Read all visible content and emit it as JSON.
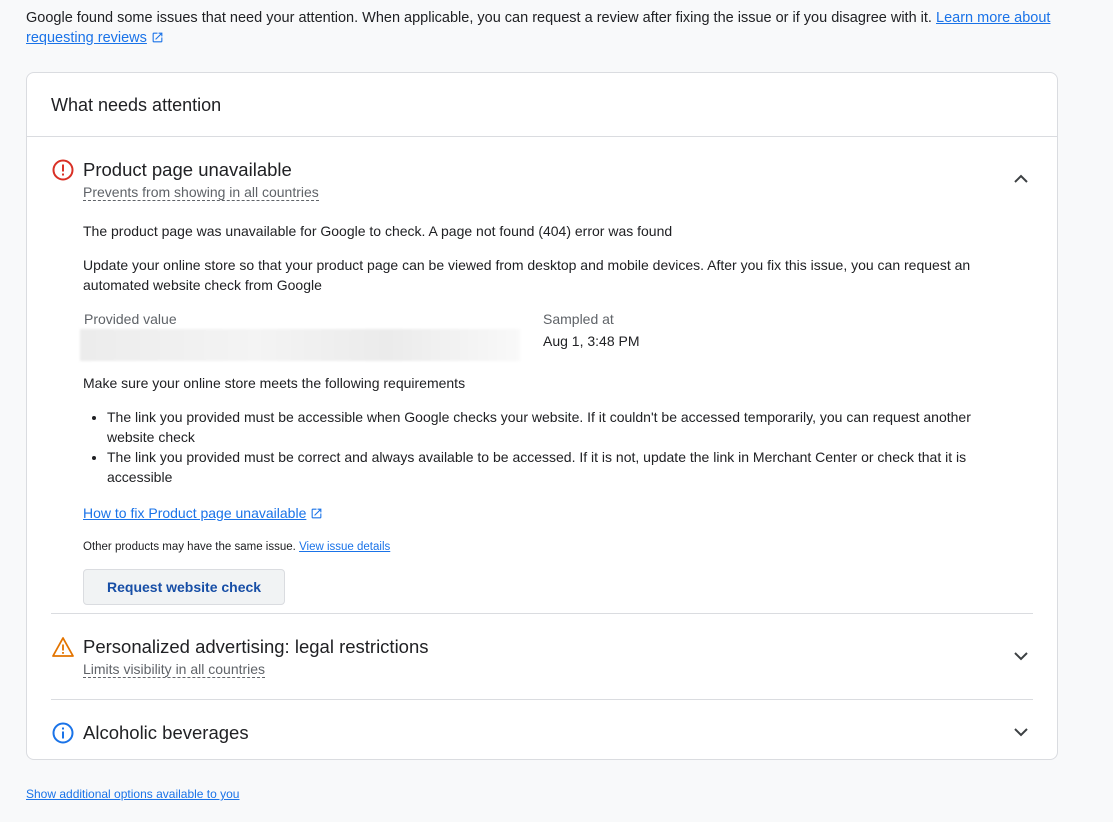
{
  "intro": {
    "text": "Google found some issues that need your attention. When applicable, you can request a review after fixing the issue or if you disagree with it.",
    "link_label": "Learn more about requesting reviews",
    "link_icon": "external-link-icon"
  },
  "card": {
    "title": "What needs attention",
    "issues": [
      {
        "title": "Product page unavailable",
        "subtitle": "Prevents from showing in all countries",
        "severity": "error",
        "icon": "error-circle-icon",
        "expanded": true,
        "detail_1": "The product page was unavailable for Google to check. A page not found (404) error was found",
        "detail_2": "Update your online store so that your product page can be viewed from desktop and mobile devices. After you fix this issue, you can request an automated website check from Google",
        "provided_value_label": "Provided value",
        "sampled_at_label": "Sampled at",
        "sampled_at_value": "Aug 1, 3:48 PM",
        "requirements_intro": "Make sure your online store meets the following requirements",
        "requirements": [
          "The link you provided must be accessible when Google checks your website. If it couldn't be accessed temporarily, you can request another website check",
          "The link you provided must be correct and always available to be accessed. If it is not, update the link in Merchant Center or check that it is accessible"
        ],
        "howto_link": "How to fix Product page unavailable",
        "other_text": "Other products may have the same issue.",
        "other_link": "View issue details",
        "button_label": "Request website check"
      },
      {
        "title": "Personalized advertising: legal restrictions",
        "subtitle": "Limits visibility in all countries",
        "severity": "warning",
        "icon": "warning-triangle-icon",
        "expanded": false
      },
      {
        "title": "Alcoholic beverages",
        "severity": "info",
        "icon": "info-circle-icon",
        "expanded": false
      }
    ]
  },
  "footer": {
    "link": "Show additional options available to you"
  },
  "colors": {
    "error": "#d93025",
    "warning": "#e37400",
    "info": "#1a73e8",
    "link": "#1a73e8",
    "button_text": "#174ea6"
  }
}
